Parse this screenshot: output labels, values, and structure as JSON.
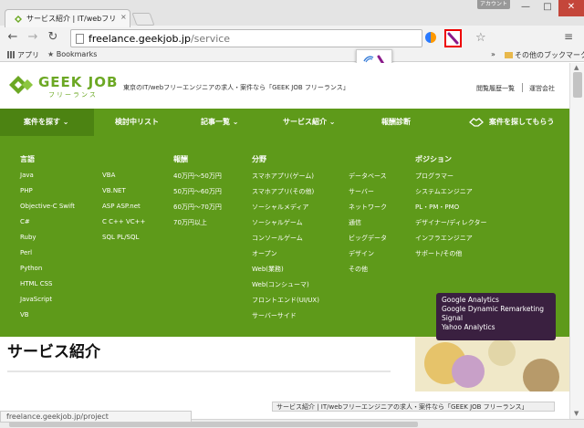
{
  "window": {
    "account_label": "アカウント",
    "controls": {
      "minimize": "—",
      "maximize": "□",
      "close": "✕"
    }
  },
  "tab": {
    "title": "サービス紹介 | IT/webフリー",
    "close": "×"
  },
  "toolbar": {
    "back": "←",
    "forward": "→",
    "reload": "↻",
    "url_host": "freelance.geekjob.jp",
    "url_path": "/service",
    "star": "☆",
    "menu": "≡"
  },
  "bookmarks": {
    "apps": "アプリ",
    "bookmarks": "Bookmarks",
    "overflow": "»",
    "other": "その他のブックマーク"
  },
  "header": {
    "logo_text": "GEEK JOB",
    "logo_sub": "フリーランス",
    "tagline": "東京のIT/webフリーエンジニアの求人・案件なら「GEEK JOB フリーランス」",
    "link_company": "閲覧履歴一覧",
    "link_operator": "運営会社"
  },
  "nav": {
    "items": [
      {
        "label": "案件を探す ⌄"
      },
      {
        "label": "検討中リスト"
      },
      {
        "label": "記事一覧 ⌄"
      },
      {
        "label": "サービス紹介 ⌄"
      },
      {
        "label": "報酬診断"
      },
      {
        "label": "案件を探してもらう"
      }
    ]
  },
  "mega": {
    "language_head": "言語",
    "languages_a": [
      "Java",
      "PHP",
      "Objective-C Swift",
      "C#",
      "Ruby",
      "Perl",
      "Python",
      "HTML CSS",
      "JavaScript",
      "VB"
    ],
    "languages_b": [
      "VBA",
      "VB.NET",
      "ASP ASP.net",
      "C C++ VC++",
      "SQL PL/SQL"
    ],
    "pay_head": "報酬",
    "pay": [
      "40万円〜50万円",
      "50万円〜60万円",
      "60万円〜70万円",
      "70万円以上"
    ],
    "field_head": "分野",
    "fields_a": [
      "スマホアプリ(ゲーム)",
      "スマホアプリ(その他)",
      "ソーシャルメディア",
      "ソーシャルゲーム",
      "コンソールゲーム",
      "オープン",
      "Web(業務)",
      "Web(コンシューマ)",
      "フロントエンド(UI/UX)",
      "サーバーサイド"
    ],
    "fields_b": [
      "データベース",
      "サーバー",
      "ネットワーク",
      "通信",
      "ビッグデータ",
      "デザイン",
      "その他"
    ],
    "position_head": "ポジション",
    "positions": [
      "プログラマー",
      "システムエンジニア",
      "PL・PM・PMO",
      "デザイナー/ディレクター",
      "インフラエンジニア",
      "サポート/その他"
    ]
  },
  "main": {
    "section_title": "サービス紹介"
  },
  "tooltip": {
    "lines": [
      "Google Analytics",
      "Google Dynamic Remarketing",
      "Signal",
      "Yahoo Analytics"
    ]
  },
  "status": {
    "url": "freelance.geekjob.jp/project"
  },
  "taskbar": {
    "title": "サービス紹介 | IT/webフリーエンジニアの求人・案件なら「GEEK JOB フリーランス」"
  },
  "colors": {
    "brand_green": "#5e9a1a",
    "active_green": "#4c8312",
    "logo_green": "#6ca824",
    "tooltip_bg": "#3a2040",
    "highlight_red": "#e00000"
  }
}
